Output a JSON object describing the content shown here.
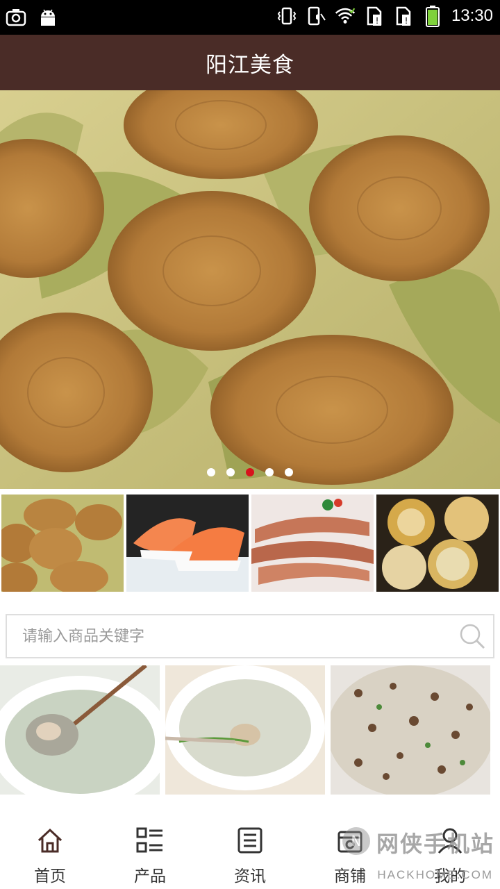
{
  "status_bar": {
    "time": "13:30",
    "icons": [
      "screenshot-icon",
      "android-icon",
      "vibrate-icon",
      "silent-icon",
      "wifi-icon",
      "sim1-icon",
      "sim2-icon",
      "battery-icon"
    ]
  },
  "header": {
    "title": "阳江美食"
  },
  "banner": {
    "image": "steamed-rice-cakes-on-leaves",
    "dots": [
      false,
      false,
      true,
      false,
      false
    ]
  },
  "thumbnails": [
    {
      "image": "rice-cakes"
    },
    {
      "image": "salmon-sushi"
    },
    {
      "image": "mantis-shrimp"
    },
    {
      "image": "packaged-pastries"
    }
  ],
  "search": {
    "placeholder": "请输入商品关键字"
  },
  "products": [
    {
      "image": "clam-soup-ladle"
    },
    {
      "image": "clam-soup-bowl"
    },
    {
      "image": "fried-rice"
    }
  ],
  "bottom_nav": [
    {
      "label": "首页",
      "icon": "home-icon"
    },
    {
      "label": "产品",
      "icon": "list-icon"
    },
    {
      "label": "资讯",
      "icon": "news-icon"
    },
    {
      "label": "商铺",
      "icon": "shop-icon"
    },
    {
      "label": "我的",
      "icon": "user-icon"
    }
  ],
  "watermark": {
    "text_cn": "网侠手机站",
    "text_en": "HACKHOME.COM"
  },
  "colors": {
    "header_bg": "#4a2c27",
    "active_dot": "#d7131c"
  }
}
